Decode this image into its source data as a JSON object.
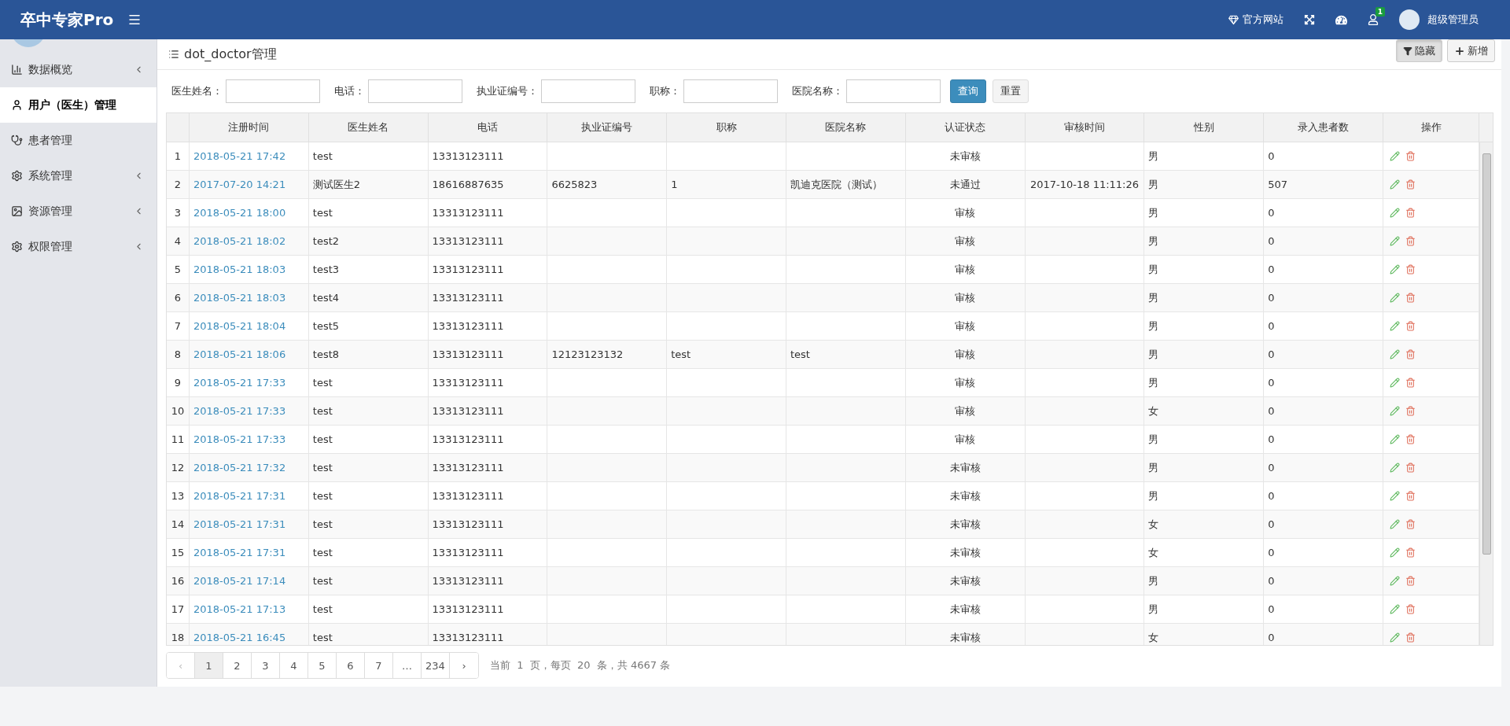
{
  "topbar": {
    "brand": "卒中专家Pro",
    "site_link": "官方网站",
    "notification_count": "1",
    "user_name": "超级管理员"
  },
  "sidebar": {
    "items": [
      {
        "label": "数据概览",
        "kind": "chart",
        "selected": false,
        "has_children": true
      },
      {
        "label": "用户（医生）管理",
        "kind": "user",
        "selected": true,
        "has_children": false
      },
      {
        "label": "患者管理",
        "kind": "stethoscope",
        "selected": false,
        "has_children": false
      },
      {
        "label": "系统管理",
        "kind": "gear",
        "selected": false,
        "has_children": true
      },
      {
        "label": "资源管理",
        "kind": "image",
        "selected": false,
        "has_children": true
      },
      {
        "label": "权限管理",
        "kind": "gear",
        "selected": false,
        "has_children": true
      }
    ]
  },
  "page": {
    "title": "dot_doctor管理",
    "actions": [
      {
        "kind": "filter",
        "label": "隐藏",
        "pressed": true
      },
      {
        "kind": "add",
        "label": "新增",
        "pressed": false
      }
    ]
  },
  "filters": {
    "fields": [
      {
        "label": "医生姓名："
      },
      {
        "label": "电话："
      },
      {
        "label": "执业证编号："
      },
      {
        "label": "职称："
      },
      {
        "label": "医院名称："
      }
    ],
    "buttons": [
      {
        "kind": "primary",
        "label": "查询"
      },
      {
        "kind": "default",
        "label": "重置"
      }
    ]
  },
  "table": {
    "columns": [
      "注册时间",
      "医生姓名",
      "电话",
      "执业证编号",
      "职称",
      "医院名称",
      "认证状态",
      "审核时间",
      "性别",
      "录入患者数",
      "操作"
    ],
    "rows": [
      {
        "index": "1",
        "registered": "2018-05-21 17:42",
        "name": "test",
        "phone": "13313123111",
        "license": "",
        "title": "",
        "hospital": "",
        "status": "未审核",
        "review_time": "",
        "gender": "男",
        "patients": "0"
      },
      {
        "index": "2",
        "registered": "2017-07-20 14:21",
        "name": "测试医生2",
        "phone": "18616887635",
        "license": "6625823",
        "title": "1",
        "hospital": "凯迪克医院（测试）",
        "status": "未通过",
        "review_time": "2017-10-18 11:11:26",
        "gender": "男",
        "patients": "507"
      },
      {
        "index": "3",
        "registered": "2018-05-21 18:00",
        "name": "test",
        "phone": "13313123111",
        "license": "",
        "title": "",
        "hospital": "",
        "status": "审核",
        "review_time": "",
        "gender": "男",
        "patients": "0"
      },
      {
        "index": "4",
        "registered": "2018-05-21 18:02",
        "name": "test2",
        "phone": "13313123111",
        "license": "",
        "title": "",
        "hospital": "",
        "status": "审核",
        "review_time": "",
        "gender": "男",
        "patients": "0"
      },
      {
        "index": "5",
        "registered": "2018-05-21 18:03",
        "name": "test3",
        "phone": "13313123111",
        "license": "",
        "title": "",
        "hospital": "",
        "status": "审核",
        "review_time": "",
        "gender": "男",
        "patients": "0"
      },
      {
        "index": "6",
        "registered": "2018-05-21 18:03",
        "name": "test4",
        "phone": "13313123111",
        "license": "",
        "title": "",
        "hospital": "",
        "status": "审核",
        "review_time": "",
        "gender": "男",
        "patients": "0"
      },
      {
        "index": "7",
        "registered": "2018-05-21 18:04",
        "name": "test5",
        "phone": "13313123111",
        "license": "",
        "title": "",
        "hospital": "",
        "status": "审核",
        "review_time": "",
        "gender": "男",
        "patients": "0"
      },
      {
        "index": "8",
        "registered": "2018-05-21 18:06",
        "name": "test8",
        "phone": "13313123111",
        "license": "12123123132",
        "title": "test",
        "hospital": "test",
        "status": "审核",
        "review_time": "",
        "gender": "男",
        "patients": "0"
      },
      {
        "index": "9",
        "registered": "2018-05-21 17:33",
        "name": "test",
        "phone": "13313123111",
        "license": "",
        "title": "",
        "hospital": "",
        "status": "审核",
        "review_time": "",
        "gender": "男",
        "patients": "0"
      },
      {
        "index": "10",
        "registered": "2018-05-21 17:33",
        "name": "test",
        "phone": "13313123111",
        "license": "",
        "title": "",
        "hospital": "",
        "status": "审核",
        "review_time": "",
        "gender": "女",
        "patients": "0"
      },
      {
        "index": "11",
        "registered": "2018-05-21 17:33",
        "name": "test",
        "phone": "13313123111",
        "license": "",
        "title": "",
        "hospital": "",
        "status": "审核",
        "review_time": "",
        "gender": "男",
        "patients": "0"
      },
      {
        "index": "12",
        "registered": "2018-05-21 17:32",
        "name": "test",
        "phone": "13313123111",
        "license": "",
        "title": "",
        "hospital": "",
        "status": "未审核",
        "review_time": "",
        "gender": "男",
        "patients": "0"
      },
      {
        "index": "13",
        "registered": "2018-05-21 17:31",
        "name": "test",
        "phone": "13313123111",
        "license": "",
        "title": "",
        "hospital": "",
        "status": "未审核",
        "review_time": "",
        "gender": "男",
        "patients": "0"
      },
      {
        "index": "14",
        "registered": "2018-05-21 17:31",
        "name": "test",
        "phone": "13313123111",
        "license": "",
        "title": "",
        "hospital": "",
        "status": "未审核",
        "review_time": "",
        "gender": "女",
        "patients": "0"
      },
      {
        "index": "15",
        "registered": "2018-05-21 17:31",
        "name": "test",
        "phone": "13313123111",
        "license": "",
        "title": "",
        "hospital": "",
        "status": "未审核",
        "review_time": "",
        "gender": "女",
        "patients": "0"
      },
      {
        "index": "16",
        "registered": "2018-05-21 17:14",
        "name": "test",
        "phone": "13313123111",
        "license": "",
        "title": "",
        "hospital": "",
        "status": "未审核",
        "review_time": "",
        "gender": "男",
        "patients": "0"
      },
      {
        "index": "17",
        "registered": "2018-05-21 17:13",
        "name": "test",
        "phone": "13313123111",
        "license": "",
        "title": "",
        "hospital": "",
        "status": "未审核",
        "review_time": "",
        "gender": "男",
        "patients": "0"
      },
      {
        "index": "18",
        "registered": "2018-05-21 16:45",
        "name": "test",
        "phone": "13313123111",
        "license": "",
        "title": "",
        "hospital": "",
        "status": "未审核",
        "review_time": "",
        "gender": "女",
        "patients": "0"
      }
    ]
  },
  "pagination": {
    "prev": "‹",
    "next": "›",
    "pages": [
      {
        "label": "1",
        "selected": true
      },
      {
        "label": "2",
        "selected": false
      },
      {
        "label": "3",
        "selected": false
      },
      {
        "label": "4",
        "selected": false
      },
      {
        "label": "5",
        "selected": false
      },
      {
        "label": "6",
        "selected": false
      },
      {
        "label": "7",
        "selected": false
      },
      {
        "label": "…",
        "selected": false
      },
      {
        "label": "234",
        "selected": false
      }
    ],
    "summary": "当前  1  页，每页  20  条，共 4667 条"
  }
}
